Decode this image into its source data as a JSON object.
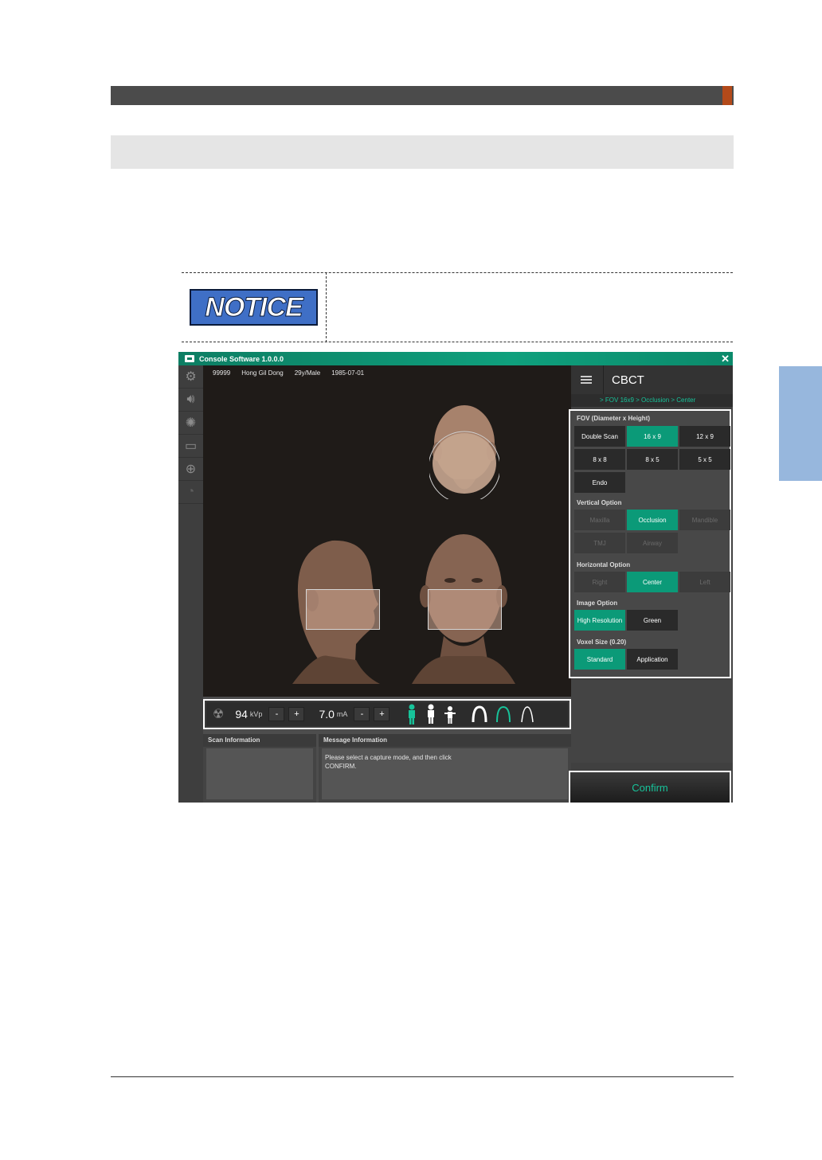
{
  "document": {
    "notice_label": "NOTICE"
  },
  "app": {
    "title": "Console Software 1.0.0.0",
    "patient": {
      "id": "99999",
      "name": "Hong Gil Dong",
      "age_sex": "29y/Male",
      "birth": "1985-07-01"
    },
    "params": {
      "kvp": "94",
      "kvp_unit": "kVp",
      "ma": "7.0",
      "ma_unit": "mA",
      "minus": "-",
      "plus": "+"
    },
    "scan_info_title": "Scan Information",
    "message_title": "Message Information",
    "message_text": "Please select a capture mode, and then click CONFIRM.",
    "mode_title": "CBCT",
    "breadcrumb": "> FOV 16x9 > Occlusion > Center",
    "fov": {
      "label": "FOV (Diameter x Height)",
      "options": [
        "Double Scan",
        "16 x 9",
        "12 x 9",
        "8 x 8",
        "8 x 5",
        "5 x 5",
        "Endo"
      ]
    },
    "vertical": {
      "label": "Vertical Option",
      "options": [
        "Maxilla",
        "Occlusion",
        "Mandible",
        "TMJ",
        "Airway"
      ]
    },
    "horizontal": {
      "label": "Horizontal Option",
      "options": [
        "Right",
        "Center",
        "Left"
      ]
    },
    "image": {
      "label": "Image Option",
      "options": [
        "High Resolution",
        "Green"
      ]
    },
    "voxel": {
      "label": "Voxel Size (0.20)",
      "options": [
        "Standard",
        "Application"
      ]
    },
    "confirm_label": "Confirm",
    "colors": {
      "accent": "#0b9a78",
      "titlebar": "#0d7e63",
      "notice_blue": "#3f6fc6"
    }
  }
}
